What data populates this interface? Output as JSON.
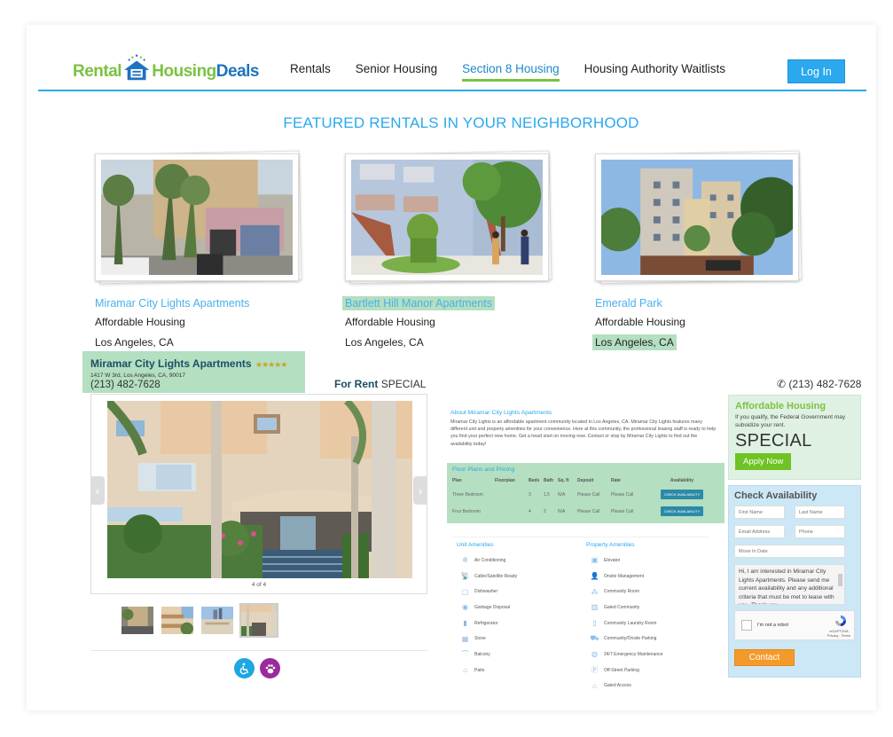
{
  "brand": {
    "logo_part1": "Rental",
    "logo_part2": "Housing",
    "logo_part3": "Deals",
    "green": "#7cc242",
    "blue": "#1e73be",
    "accent": "#2ba8ee"
  },
  "nav": {
    "items": [
      {
        "label": "Rentals",
        "active": false
      },
      {
        "label": "Senior Housing",
        "active": false
      },
      {
        "label": "Section 8 Housing",
        "active": true
      },
      {
        "label": "Housing Authority Waitlists",
        "active": false
      }
    ],
    "login_label": "Log In"
  },
  "featured": {
    "title": "FEATURED RENTALS IN YOUR NEIGHBORHOOD",
    "listings": [
      {
        "name": "Miramar City Lights Apartments",
        "type": "Affordable Housing",
        "city": "Los Angeles, CA"
      },
      {
        "name": "Bartlett Hill Manor Apartments",
        "type": "Affordable Housing",
        "city": "Los Angeles, CA"
      },
      {
        "name": "Emerald Park",
        "type": "Affordable Housing",
        "city": "Los Angeles, CA"
      }
    ]
  },
  "property": {
    "name": "Miramar City Lights Apartments",
    "stars": "★★★★★",
    "rating": 5,
    "address": "1417 W 3rd, Los Angeles, CA, 90017",
    "phone": "(213) 482-7628",
    "for_rent_label": "For Rent",
    "special_label": "SPECIAL",
    "top_phone": "(213) 482-7628"
  },
  "gallery": {
    "counter": "4 of 4",
    "prev_icon": "‹",
    "next_icon": "›",
    "current": 4,
    "total": 4
  },
  "features": [
    {
      "icon": "wheelchair-icon",
      "glyph": "♿",
      "color": "#1ea7e1"
    },
    {
      "icon": "paw-icon",
      "glyph": "🐾",
      "color": "#9b2b9b"
    }
  ],
  "about": {
    "title": "About Miramar City Lights Apartments",
    "text": "Miramar City Lights is an affordable apartment community located in Los Angeles, CA. Miramar City Lights features many different unit and property amenities for your convenience. Here at this community, the professional leasing staff is ready to help you find your perfect new home. Get a head start on moving now. Contact or stop by Miramar City Lights to find out the availability today!"
  },
  "floorplans": {
    "title": "Floor Plans and Pricing",
    "headers": [
      "Plan",
      "Floorplan",
      "Beds",
      "Bath",
      "Sq. ft",
      "Deposit",
      "Rate",
      "Availability"
    ],
    "rows": [
      {
        "plan": "Three Bedroom",
        "floorplan": "",
        "beds": "3",
        "bath": "1.5",
        "sqft": "N/A",
        "deposit": "Please Call",
        "rate": "Please Call",
        "button": "CHECK AVAILABILITY"
      },
      {
        "plan": "Four Bedroom",
        "floorplan": "",
        "beds": "4",
        "bath": "2",
        "sqft": "N/A",
        "deposit": "Please Call",
        "rate": "Please Call",
        "button": "CHECK AVAILABILITY"
      }
    ]
  },
  "unit_amenities": {
    "title": "Unit Amenities",
    "items": [
      {
        "label": "Air Conditioning",
        "icon": "snowflake-icon",
        "glyph": "✲"
      },
      {
        "label": "Cable/Satellite Ready",
        "icon": "satellite-icon",
        "glyph": "📡"
      },
      {
        "label": "Dishwasher",
        "icon": "dishwasher-icon",
        "glyph": "▢"
      },
      {
        "label": "Garbage Disposal",
        "icon": "disposal-icon",
        "glyph": "◉"
      },
      {
        "label": "Refrigerator",
        "icon": "refrigerator-icon",
        "glyph": "▮"
      },
      {
        "label": "Stove",
        "icon": "stove-icon",
        "glyph": "▦"
      },
      {
        "label": "Balcony",
        "icon": "balcony-icon",
        "glyph": "⌒"
      },
      {
        "label": "Patio",
        "icon": "patio-icon",
        "glyph": "⌂"
      }
    ]
  },
  "property_amenities": {
    "title": "Property Amenities",
    "items": [
      {
        "label": "Elevator",
        "icon": "elevator-icon",
        "glyph": "▣"
      },
      {
        "label": "Onsite Management",
        "icon": "manager-icon",
        "glyph": "👤"
      },
      {
        "label": "Community Room",
        "icon": "community-room-icon",
        "glyph": "⁂"
      },
      {
        "label": "Gated Community",
        "icon": "gate-icon",
        "glyph": "▥"
      },
      {
        "label": "Community Laundry Room",
        "icon": "laundry-icon",
        "glyph": "▯"
      },
      {
        "label": "Community/Onsite Parking",
        "icon": "parking-cars-icon",
        "glyph": "⛟"
      },
      {
        "label": "24/7 Emergency Maintenance",
        "icon": "maintenance-icon",
        "glyph": "◍"
      },
      {
        "label": "Off-Street Parking",
        "icon": "parking-icon",
        "glyph": "Ⓟ"
      },
      {
        "label": "Gated Access",
        "icon": "gated-access-icon",
        "glyph": "⌂"
      }
    ]
  },
  "affordable": {
    "title": "Affordable Housing",
    "text": "If you qualify, the Federal Government may subsidize your rent.",
    "special": "SPECIAL",
    "apply_label": "Apply Now"
  },
  "check_availability": {
    "title": "Check Availability",
    "first_name_placeholder": "First Name",
    "last_name_placeholder": "Last Name",
    "email_placeholder": "Email Address",
    "phone_placeholder": "Phone",
    "move_in_placeholder": "Move In Date",
    "message": "Hi, I am interested in Miramar City Lights Apartments. Please send me current availability and any additional criteria that must be met to lease with you. Thank you.",
    "captcha_label": "I'm not a robot",
    "captcha_brand": "reCAPTCHA",
    "captcha_links": "Privacy - Terms",
    "contact_label": "Contact"
  }
}
